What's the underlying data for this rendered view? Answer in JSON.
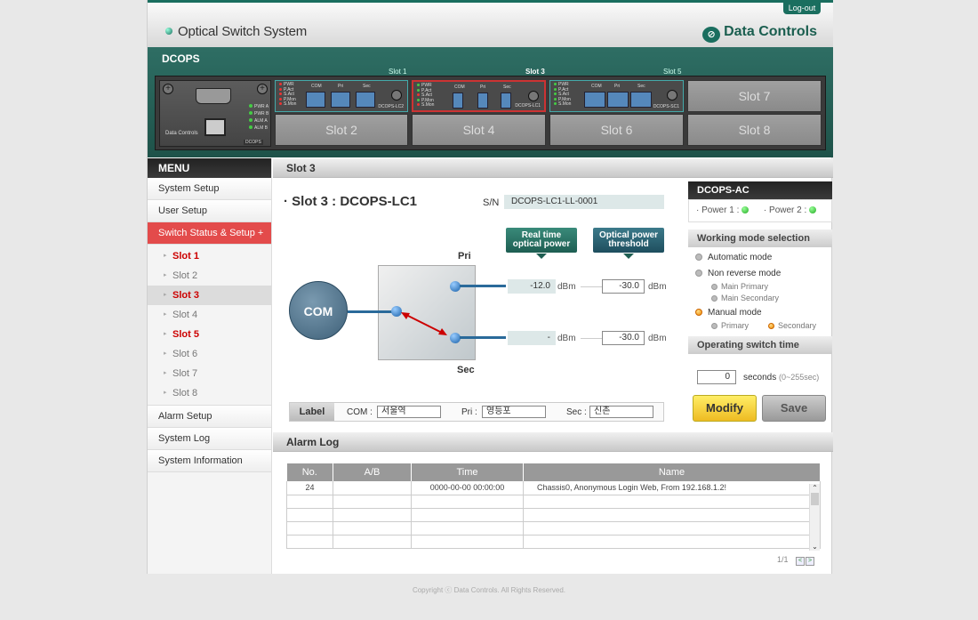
{
  "header": {
    "logout": "Log-out",
    "app_title": "Optical Switch System",
    "brand": "Data Controls"
  },
  "device": {
    "title": "DCOPS",
    "slot_captions": [
      "Slot 1",
      "Slot 3",
      "Slot 5"
    ],
    "mgmt_logo": "Data Controls",
    "mgmt_id": "DCOPS",
    "mgmt_leds": [
      "PWR A",
      "PWR B",
      "ALM A",
      "ALM B"
    ],
    "card_leds": [
      "PWR",
      "P.Act",
      "S.Act",
      "P.Mon",
      "S.Mon"
    ],
    "cards": [
      {
        "id": "DCOPS-LC2",
        "ports": [
          "COM",
          "Pri",
          "Sec"
        ],
        "subports": [
          "Tx",
          "Rx",
          "Tx",
          "Rx",
          "Tx",
          "Rx"
        ]
      },
      {
        "id": "DCOPS-LC1",
        "ports": [
          "COM",
          "Pri",
          "Sec"
        ]
      },
      {
        "id": "DCOPS-SC1",
        "ports": [
          "COM",
          "Pri",
          "Sec"
        ]
      }
    ],
    "empty_slots": [
      "Slot 7",
      "Slot 2",
      "Slot 4",
      "Slot 6",
      "Slot 8"
    ]
  },
  "menu": {
    "title": "MENU",
    "items": [
      "System Setup",
      "User Setup",
      "Switch Status & Setup +"
    ],
    "slots": [
      "Slot 1",
      "Slot 2",
      "Slot 3",
      "Slot 4",
      "Slot 5",
      "Slot 6",
      "Slot 7",
      "Slot 8"
    ],
    "items_after": [
      "Alarm Setup",
      "System Log",
      "System Information"
    ]
  },
  "main": {
    "section_title": "Slot 3",
    "heading": "· Slot 3 : DCOPS-LC1",
    "sn_label": "S/N",
    "sn_value": "DCOPS-LC1-LL-0001",
    "callout_realtime_1": "Real time",
    "callout_realtime_2": "optical power",
    "callout_threshold_1": "Optical power",
    "callout_threshold_2": "threshold",
    "com": "COM",
    "pri": "Pri",
    "sec": "Sec",
    "pri_realtime": "-12.0",
    "sec_realtime": "-",
    "pri_threshold": "-30.0",
    "sec_threshold": "-30.0",
    "unit": "dBm",
    "label_title": "Label",
    "label_com_key": "COM :",
    "label_com_val": "서울역",
    "label_pri_key": "Pri :",
    "label_pri_val": "영등포",
    "label_sec_key": "Sec :",
    "label_sec_val": "신촌"
  },
  "right": {
    "title": "DCOPS-AC",
    "power1": "· Power 1 :",
    "power2": "· Power 2 :",
    "mode_title": "Working mode selection",
    "auto": "Automatic mode",
    "nonrev": "Non reverse mode",
    "main_primary": "Main Primary",
    "main_secondary": "Main Secondary",
    "manual": "Manual mode",
    "primary": "Primary",
    "secondary": "Secondary",
    "optime_title": "Operating switch time",
    "optime_value": "0",
    "optime_unit": "seconds",
    "optime_range": "(0~255sec)",
    "modify": "Modify",
    "save": "Save"
  },
  "alarm": {
    "title": "Alarm Log",
    "columns": [
      "No.",
      "A/B",
      "Time",
      "Name"
    ],
    "rows": [
      [
        "24",
        "",
        "0000-00-00  00:00:00",
        "Chassis0, Anonymous Login Web, From 192.168.1.2!"
      ],
      [
        "",
        "",
        "",
        ""
      ],
      [
        "",
        "",
        "",
        ""
      ],
      [
        "",
        "",
        "",
        ""
      ],
      [
        "",
        "",
        "",
        ""
      ]
    ],
    "pager": "1/1"
  },
  "footer": {
    "copyright": "Copyright ⓒ Data Controls. All Rights Reserved."
  }
}
